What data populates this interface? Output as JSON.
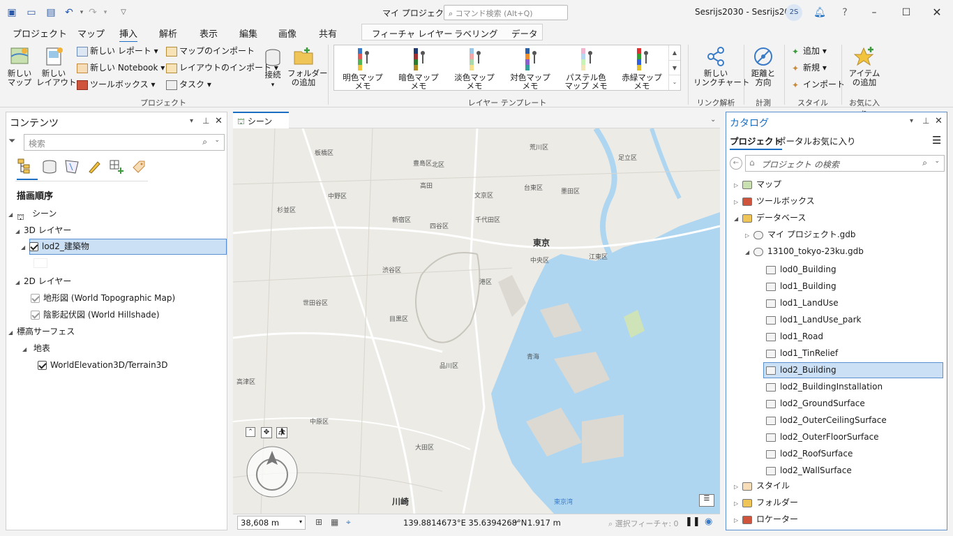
{
  "app": {
    "title": "マイ プロジェクト",
    "command_placeholder": "コマンド検索 (Alt+Q)",
    "user": "Sesrijs2030 - Sesrijs2030",
    "avatar": "2S"
  },
  "tabs": [
    "プロジェクト",
    "マップ",
    "挿入",
    "解析",
    "表示",
    "編集",
    "画像",
    "共有"
  ],
  "active_tab": "挿入",
  "context_tabs": [
    "フィーチャ レイヤー",
    "ラベリング",
    "データ"
  ],
  "ribbon": {
    "new_map": "新しい\nマップ",
    "new_layout": "新しい\nレイアウト",
    "new_report": "新しい レポート",
    "new_notebook": "新しい Notebook",
    "toolbox": "ツールボックス",
    "import_map": "マップのインポート",
    "import_layout": "レイアウトのインポート",
    "task": "タスク",
    "connect": "接続",
    "add_folder": "フォルダー\nの追加",
    "group_project": "プロジェクト",
    "gallery": [
      "明色マップ\nメモ",
      "暗色マップ\nメモ",
      "淡色マップ\nメモ",
      "対色マップ\nメモ",
      "パステル色\nマップ メモ",
      "赤緑マップ\nメモ"
    ],
    "group_layer_template": "レイヤー テンプレート",
    "new_link_chart": "新しい\nリンクチャート",
    "group_link": "リンク解析",
    "distance": "距離と\n方向",
    "group_measure": "計測",
    "style_add": "追加",
    "style_new": "新規",
    "style_import": "インポート",
    "group_style": "スタイル",
    "add_item": "アイテム\nの追加",
    "group_fav": "お気に入り"
  },
  "contents": {
    "title": "コンテンツ",
    "search_placeholder": "検索",
    "draw_order": "描画順序",
    "scene": "シーン",
    "layers_3d": "3D レイヤー",
    "lod2": "lod2_建築物",
    "layers_2d": "2D レイヤー",
    "topo": "地形図 (World Topographic Map)",
    "hillshade": "陰影起伏図 (World Hillshade)",
    "elev": "標高サーフェス",
    "ground": "地表",
    "terrain": "WorldElevation3D/Terrain3D"
  },
  "map": {
    "tab": "シーン",
    "scale": "38,608 m",
    "coords": "139.8814673°E 35.6394268°N",
    "elev": "1.917 m",
    "selected": "選択フィーチャ: 0",
    "labels": [
      {
        "t": "板橋区"
      },
      {
        "t": "北区"
      },
      {
        "t": "荒川区"
      },
      {
        "t": "足立区"
      },
      {
        "t": "豊島区"
      },
      {
        "t": "台東区"
      },
      {
        "t": "墨田区"
      },
      {
        "t": "中野区"
      },
      {
        "t": "文京区"
      },
      {
        "t": "杉並区"
      },
      {
        "t": "新宿区"
      },
      {
        "t": "四谷区"
      },
      {
        "t": "千代田区"
      },
      {
        "t": "東京"
      },
      {
        "t": "中央区"
      },
      {
        "t": "江東区"
      },
      {
        "t": "渋谷区"
      },
      {
        "t": "世田谷区"
      },
      {
        "t": "港区"
      },
      {
        "t": "目黒区"
      },
      {
        "t": "品川区"
      },
      {
        "t": "中原区"
      },
      {
        "t": "大田区"
      },
      {
        "t": "川崎"
      },
      {
        "t": "青海"
      },
      {
        "t": "高田"
      },
      {
        "t": "東京湾"
      },
      {
        "t": "高津区"
      }
    ]
  },
  "catalog": {
    "title": "カタログ",
    "tabs": [
      "プロジェクト",
      "ポータル",
      "お気に入り"
    ],
    "search_placeholder": "プロジェクト の検索",
    "items": [
      "マップ",
      "ツールボックス",
      "データベース",
      "マイ プロジェクト.gdb",
      "13100_tokyo-23ku.gdb"
    ],
    "datasets": [
      "lod0_Building",
      "lod1_Building",
      "lod1_LandUse",
      "lod1_LandUse_park",
      "lod1_Road",
      "lod1_TinRelief",
      "lod2_Building",
      "lod2_BuildingInstallation",
      "lod2_GroundSurface",
      "lod2_OuterCeilingSurface",
      "lod2_OuterFloorSurface",
      "lod2_RoofSurface",
      "lod2_WallSurface"
    ],
    "bottom": [
      "スタイル",
      "フォルダー",
      "ロケーター"
    ]
  },
  "colors": {
    "accent": "#1b6ec2",
    "selection": "#cce0f5",
    "water": "#aed6f1"
  }
}
